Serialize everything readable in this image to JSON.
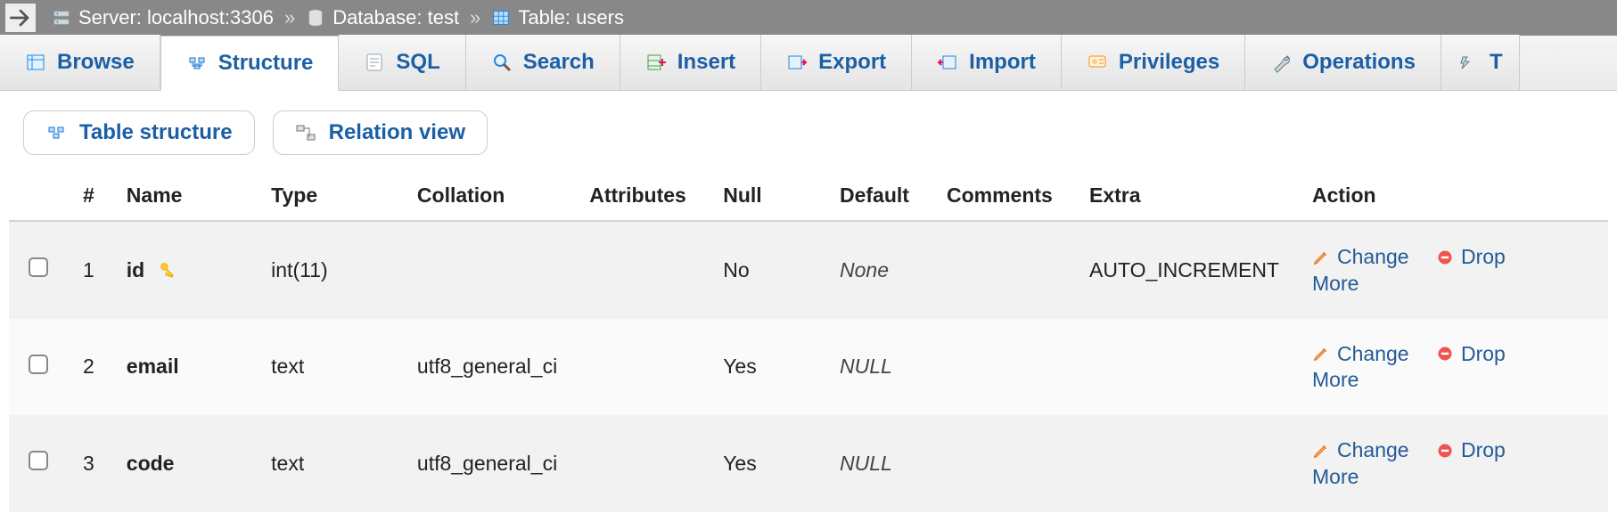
{
  "breadcrumb": {
    "server_label": "Server:",
    "server_value": "localhost:3306",
    "database_label": "Database:",
    "database_value": "test",
    "table_label": "Table:",
    "table_value": "users"
  },
  "tabs": [
    {
      "label": "Browse",
      "active": false
    },
    {
      "label": "Structure",
      "active": true
    },
    {
      "label": "SQL",
      "active": false
    },
    {
      "label": "Search",
      "active": false
    },
    {
      "label": "Insert",
      "active": false
    },
    {
      "label": "Export",
      "active": false
    },
    {
      "label": "Import",
      "active": false
    },
    {
      "label": "Privileges",
      "active": false
    },
    {
      "label": "Operations",
      "active": false
    },
    {
      "label": "T",
      "active": false
    }
  ],
  "subtabs": {
    "structure": "Table structure",
    "relation": "Relation view"
  },
  "headers": {
    "num": "#",
    "name": "Name",
    "type": "Type",
    "collation": "Collation",
    "attributes": "Attributes",
    "null": "Null",
    "default": "Default",
    "comments": "Comments",
    "extra": "Extra",
    "action": "Action"
  },
  "action_labels": {
    "change": "Change",
    "drop": "Drop",
    "more": "More"
  },
  "columns": [
    {
      "num": "1",
      "name": "id",
      "pk": true,
      "type": "int(11)",
      "collation": "",
      "attributes": "",
      "null": "No",
      "default": "None",
      "comments": "",
      "extra": "AUTO_INCREMENT"
    },
    {
      "num": "2",
      "name": "email",
      "pk": false,
      "type": "text",
      "collation": "utf8_general_ci",
      "attributes": "",
      "null": "Yes",
      "default": "NULL",
      "comments": "",
      "extra": ""
    },
    {
      "num": "3",
      "name": "code",
      "pk": false,
      "type": "text",
      "collation": "utf8_general_ci",
      "attributes": "",
      "null": "Yes",
      "default": "NULL",
      "comments": "",
      "extra": ""
    }
  ]
}
